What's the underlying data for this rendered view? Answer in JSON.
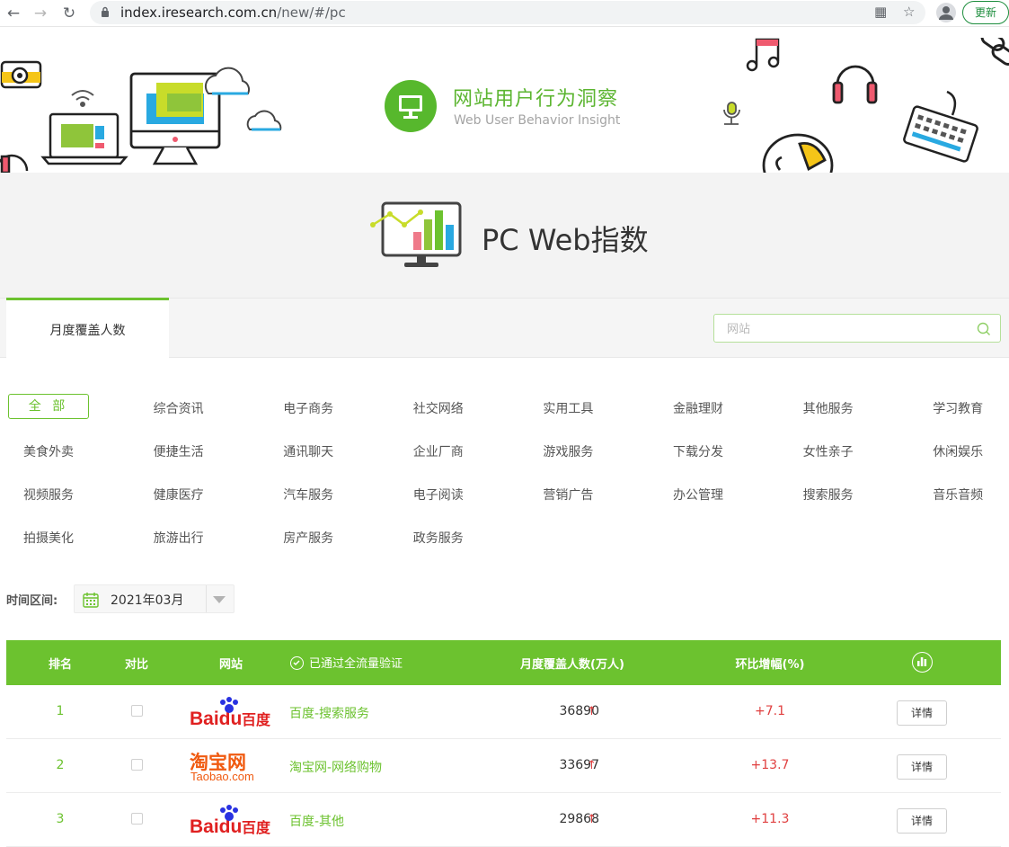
{
  "browser": {
    "url_host": "index.iresearch.com.cn",
    "url_path": "/new/#/pc",
    "update_label": "更新"
  },
  "banner": {
    "title": "网站用户行为洞察",
    "subtitle": "Web User Behavior Insight"
  },
  "hero": {
    "title": "PC Web指数"
  },
  "tabs": [
    {
      "label": "月度覆盖人数",
      "active": true
    }
  ],
  "search": {
    "placeholder": "网站"
  },
  "categories": {
    "all_label": "全 部",
    "items": [
      "综合资讯",
      "电子商务",
      "社交网络",
      "实用工具",
      "金融理财",
      "其他服务",
      "学习教育",
      "美食外卖",
      "便捷生活",
      "通讯聊天",
      "企业厂商",
      "游戏服务",
      "下载分发",
      "女性亲子",
      "休闲娱乐",
      "视频服务",
      "健康医疗",
      "汽车服务",
      "电子阅读",
      "营销广告",
      "办公管理",
      "搜索服务",
      "音乐音频",
      "拍摄美化",
      "旅游出行",
      "房产服务",
      "政务服务"
    ]
  },
  "time": {
    "label": "时间区间:",
    "value": "2021年03月"
  },
  "table": {
    "headers": {
      "rank": "排名",
      "compare": "对比",
      "site": "网站",
      "verified": "已通过全流量验证",
      "coverage": "月度覆盖人数(万人)",
      "mom": "环比增幅(%)"
    },
    "rows": [
      {
        "rank": "1",
        "logo": "Baidu",
        "logo_cn": "百度",
        "site": "百度-搜索服务",
        "coverage": "36890",
        "mom": "+7.1",
        "detail": "详情"
      },
      {
        "rank": "2",
        "logo": "淘宝网",
        "logo_en": "Taobao.com",
        "site": "淘宝网-网络购物",
        "coverage": "33697",
        "mom": "+13.7",
        "detail": "详情"
      },
      {
        "rank": "3",
        "logo": "Baidu",
        "logo_cn": "百度",
        "site": "百度-其他",
        "coverage": "29868",
        "mom": "+11.3",
        "detail": "详情"
      }
    ]
  },
  "colors": {
    "accent": "#6cc22f",
    "up": "#e04040"
  }
}
